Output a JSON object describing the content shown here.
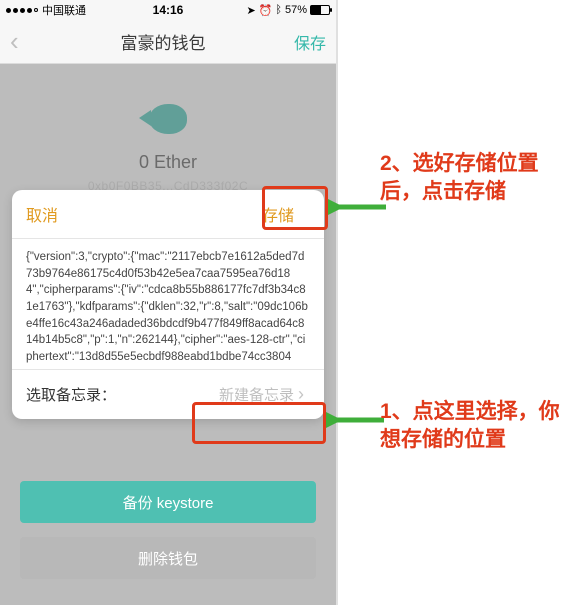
{
  "statusbar": {
    "carrier": "中国联通",
    "time": "14:16",
    "battery_pct": "57%"
  },
  "navbar": {
    "title": "富豪的钱包",
    "save": "保存"
  },
  "wallet": {
    "balance": "0 Ether",
    "address": "0xb0F0BB35...CdD333f02C"
  },
  "buttons": {
    "backup": "备份 keystore",
    "delete": "删除钱包"
  },
  "sheet": {
    "cancel": "取消",
    "store": "存储",
    "json_text": "{\"version\":3,\"crypto\":{\"mac\":\"2117ebcb7e1612a5ded7d73b9764e86175c4d0f53b42e5ea7caa7595ea76d184\",\"cipherparams\":{\"iv\":\"cdca8b55b886177fc7df3b34c81e1763\"},\"kdfparams\":{\"dklen\":32,\"r\":8,\"salt\":\"09dc106be4ffe16c43a246adaded36bdcdf9b477f849ff8acad64c814b14b5c8\",\"p\":1,\"n\":262144},\"cipher\":\"aes-128-ctr\",\"ciphertext\":\"13d8d55e5ecbdf988eabd1bdbe74cc3804",
    "memo_label": "选取备忘录：",
    "memo_new": "新建备忘录"
  },
  "annotations": {
    "a2": "2、选好存储位置后，点击存储",
    "a1": "1、点这里选择，你想存储的位置"
  }
}
